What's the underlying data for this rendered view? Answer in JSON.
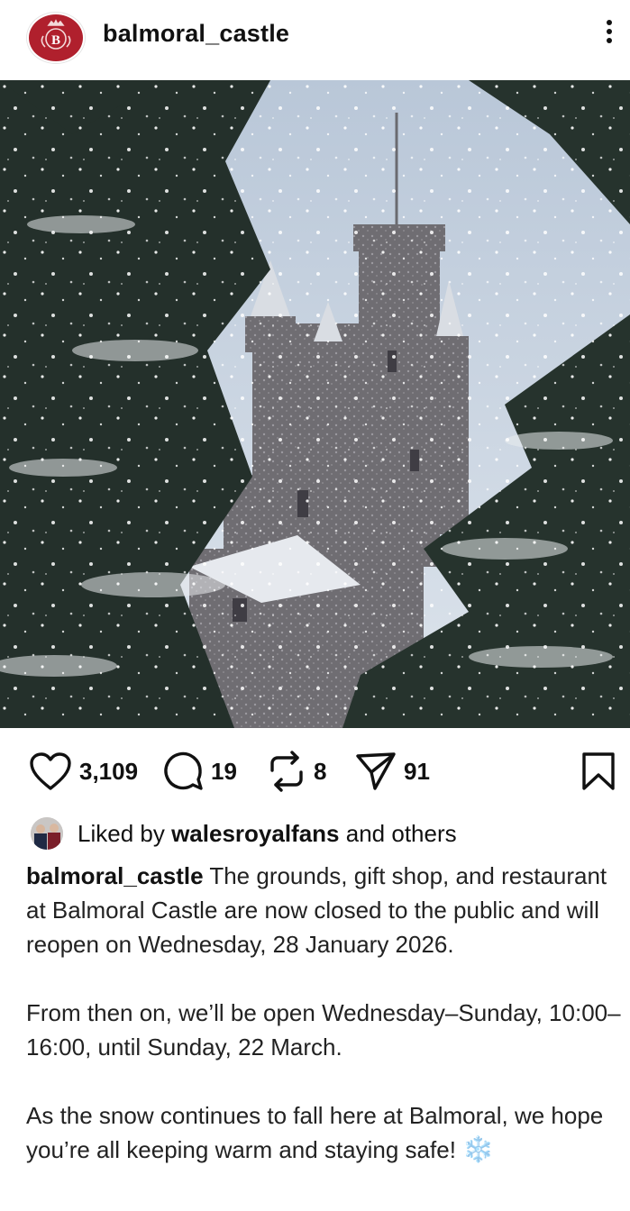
{
  "post": {
    "username": "balmoral_castle",
    "counts": {
      "likes": "3,109",
      "comments": "19",
      "reposts": "8",
      "shares": "91"
    },
    "liked_by": {
      "prefix": "Liked by",
      "user": "walesroyalfans",
      "suffix": "and others"
    },
    "caption": {
      "user": "balmoral_castle",
      "para1": "The grounds, gift shop, and restaurant at Balmoral Castle are now closed to the public and will reopen on Wednesday, 28 January 2026.",
      "para2": "From then on, we’ll be open Wednesday–Sunday, 10:00–16:00, until Sunday, 22 March.",
      "para3": "As the snow continues to fall here at Balmoral, we hope you’re all keeping warm and staying safe!",
      "emoji": "❄️"
    }
  },
  "icons": {
    "avatar": "crowned-b-crest-icon",
    "more": "more-vertical-icon",
    "like": "heart-icon",
    "comment": "comment-bubble-icon",
    "repost": "repost-icon",
    "share": "paper-plane-icon",
    "save": "bookmark-icon"
  },
  "colors": {
    "brand": "#b0202d",
    "snowflake": "#4aa0d8"
  }
}
